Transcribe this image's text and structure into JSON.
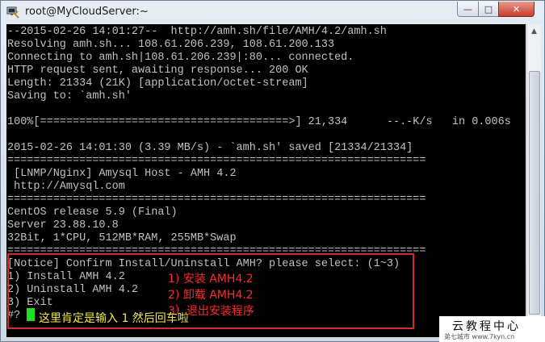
{
  "window": {
    "title": "root@MyCloudServer:~",
    "minimize": "—",
    "maximize": "□",
    "close": "✕"
  },
  "terminal": {
    "lines": [
      "--2015-02-26 14:01:27--  http://amh.sh/file/AMH/4.2/amh.sh",
      "Resolving amh.sh... 108.61.206.239, 108.61.200.133",
      "Connecting to amh.sh|108.61.206.239|:80... connected.",
      "HTTP request sent, awaiting response... 200 OK",
      "Length: 21334 (21K) [application/octet-stream]",
      "Saving to: `amh.sh'",
      "",
      "100%[======================================>] 21,334      --.-K/s   in 0.006s",
      "",
      "2015-02-26 14:01:30 (3.39 MB/s) - `amh.sh' saved [21334/21334]",
      "================================================================",
      " [LNMP/Nginx] Amysql Host - AMH 4.2",
      " http://Amysql.com",
      "================================================================",
      "CentOS release 5.9 (Final)",
      "Server 23.88.10.8",
      "32Bit, 1*CPU, 512MB*RAM, 255MB*Swap",
      "================================================================",
      "[Notice] Confirm Install/Uninstall AMH? please select: (1~3)",
      "1) Install AMH 4.2",
      "2) Uninstall AMH 4.2",
      "3) Exit",
      "#?"
    ]
  },
  "annotations": {
    "opt1": "1) 安装 AMH4.2",
    "opt2": "2) 卸载 AMH4.2",
    "opt3": "3）退出安装程序",
    "hint": "这里肯定是输入 1 然后回车啦"
  },
  "watermark": {
    "title": "云教程中心",
    "sub": "弟七城市  www.7kyn.cn"
  }
}
